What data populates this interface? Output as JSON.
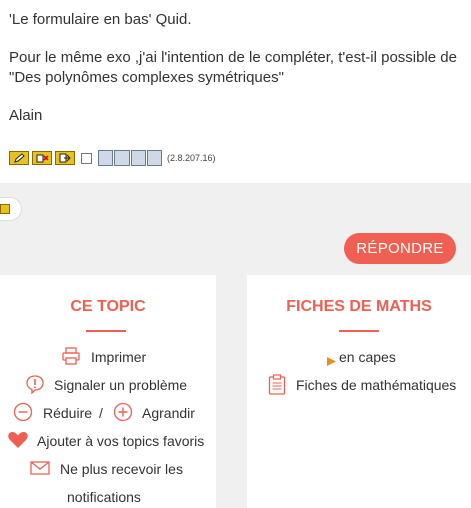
{
  "post": {
    "line1": "'Le formulaire en bas' Quid.",
    "line2": "Pour le même exo ,j'ai l'intention de le compléter,  t'est-il possible de",
    "line3": "\"Des polynômes complexes symétriques\"",
    "signature": "Alain",
    "ip": "(2.8.207.16)"
  },
  "actions": {
    "reply_label": "RÉPONDRE"
  },
  "topic_box": {
    "title": "CE TOPIC",
    "print_label": "Imprimer",
    "report_label": "Signaler un problème",
    "reduce_label": "Réduire",
    "separator": "/",
    "enlarge_label": "Agrandir",
    "favorite_label": "Ajouter à vos topics favoris",
    "unsubscribe_line1": "Ne plus recevoir les",
    "unsubscribe_line2": "notifications"
  },
  "fiches_box": {
    "title": "FICHES DE MATHS",
    "capes_label": "en capes",
    "fiches_label": "Fiches de mathématiques"
  },
  "colors": {
    "accent": "#ef5f52",
    "background_gray": "#f0f0f0"
  },
  "icons": [
    "edit-icon",
    "delete-icon",
    "reply-icon",
    "select-checkbox",
    "moderation-icons",
    "printer-icon",
    "alert-icon",
    "minus-circle-icon",
    "plus-circle-icon",
    "heart-icon",
    "envelope-icon",
    "arrow-right-icon",
    "clipboard-icon"
  ]
}
